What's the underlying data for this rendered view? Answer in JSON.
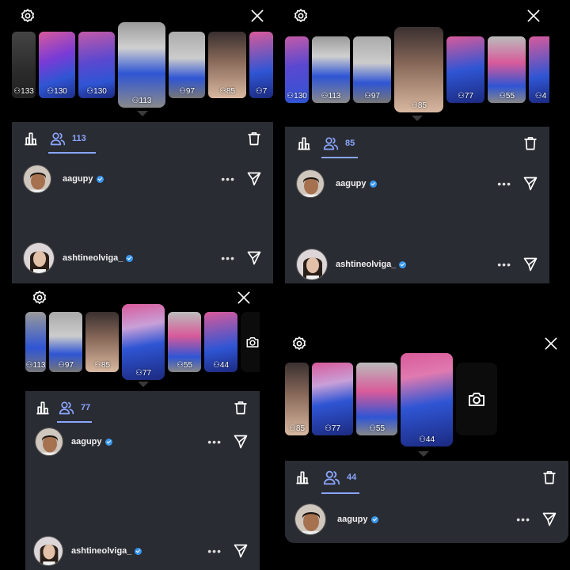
{
  "colors": {
    "background": "#000000",
    "sheet": "#2a2c33",
    "accent": "#8aa6ff",
    "verified": "#3897f0",
    "thumb_blue": "#2f55d4",
    "thumb_pink": "#d85a9a"
  },
  "icons": {
    "settings": "gear-icon",
    "close": "close-icon",
    "insights": "bar-chart-icon",
    "viewers": "viewers-icon",
    "delete": "trash-icon",
    "more": "more-dots-icon",
    "send": "send-icon",
    "camera": "camera-icon"
  },
  "panels": [
    {
      "thumb_counts": [
        "133",
        "130",
        "130",
        "113",
        "97",
        "85",
        "7"
      ],
      "selected_index": 3,
      "viewer_count": "113",
      "viewers": [
        {
          "username": "aagupy",
          "verified": true,
          "more": "•••"
        },
        {
          "username": "ashtineolviga_",
          "verified": true,
          "more": "•••"
        }
      ]
    },
    {
      "thumb_counts": [
        "130",
        "113",
        "97",
        "85",
        "77",
        "55",
        "4"
      ],
      "selected_index": 3,
      "viewer_count": "85",
      "viewers": [
        {
          "username": "aagupy",
          "verified": true,
          "more": "•••"
        },
        {
          "username": "ashtineolviga_",
          "verified": true,
          "more": "•••"
        }
      ]
    },
    {
      "thumb_counts": [
        "113",
        "97",
        "85",
        "77",
        "55",
        "44"
      ],
      "selected_index": 3,
      "viewer_count": "77",
      "viewers": [
        {
          "username": "aagupy",
          "verified": true,
          "more": "•••"
        },
        {
          "username": "ashtineolviga_",
          "verified": true,
          "more": "•••"
        }
      ]
    },
    {
      "thumb_counts": [
        "85",
        "77",
        "55",
        "44"
      ],
      "selected_index": 3,
      "viewer_count": "44",
      "viewers": [
        {
          "username": "aagupy",
          "verified": true,
          "more": "•••"
        }
      ]
    }
  ]
}
